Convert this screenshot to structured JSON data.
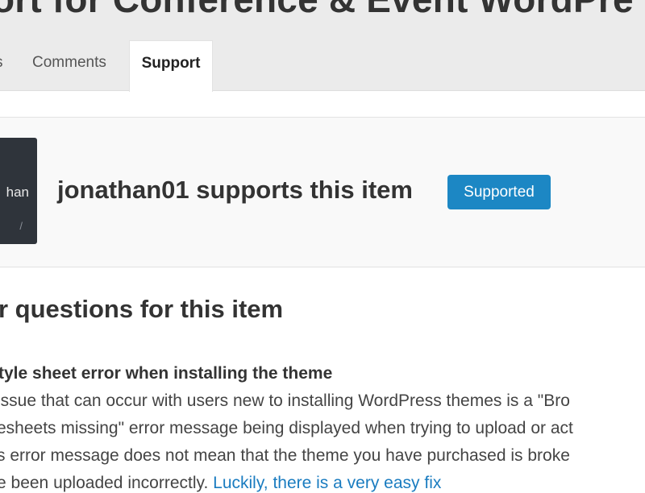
{
  "header": {
    "title": "ort for Conference & Event WordPre"
  },
  "tabs": {
    "items_label": "s",
    "comments_label": "Comments",
    "support_label": "Support"
  },
  "support": {
    "avatar_text": "han",
    "avatar_subtext": "/",
    "heading": "jonathan01 supports this item",
    "badge": "Supported",
    "badge_color": "#1c87c4"
  },
  "questions": {
    "title": "r questions for this item",
    "item_title": "tyle sheet error when installing the theme",
    "answer_lines": [
      "issue that can occur with users new to installing WordPress themes is a \"Bro",
      "esheets missing\" error message being displayed when trying to upload or act",
      "s error message does not mean that the theme you have purchased is broke",
      "e been uploaded incorrectly."
    ],
    "answer_link": "Luckily, there is a very easy fix"
  }
}
